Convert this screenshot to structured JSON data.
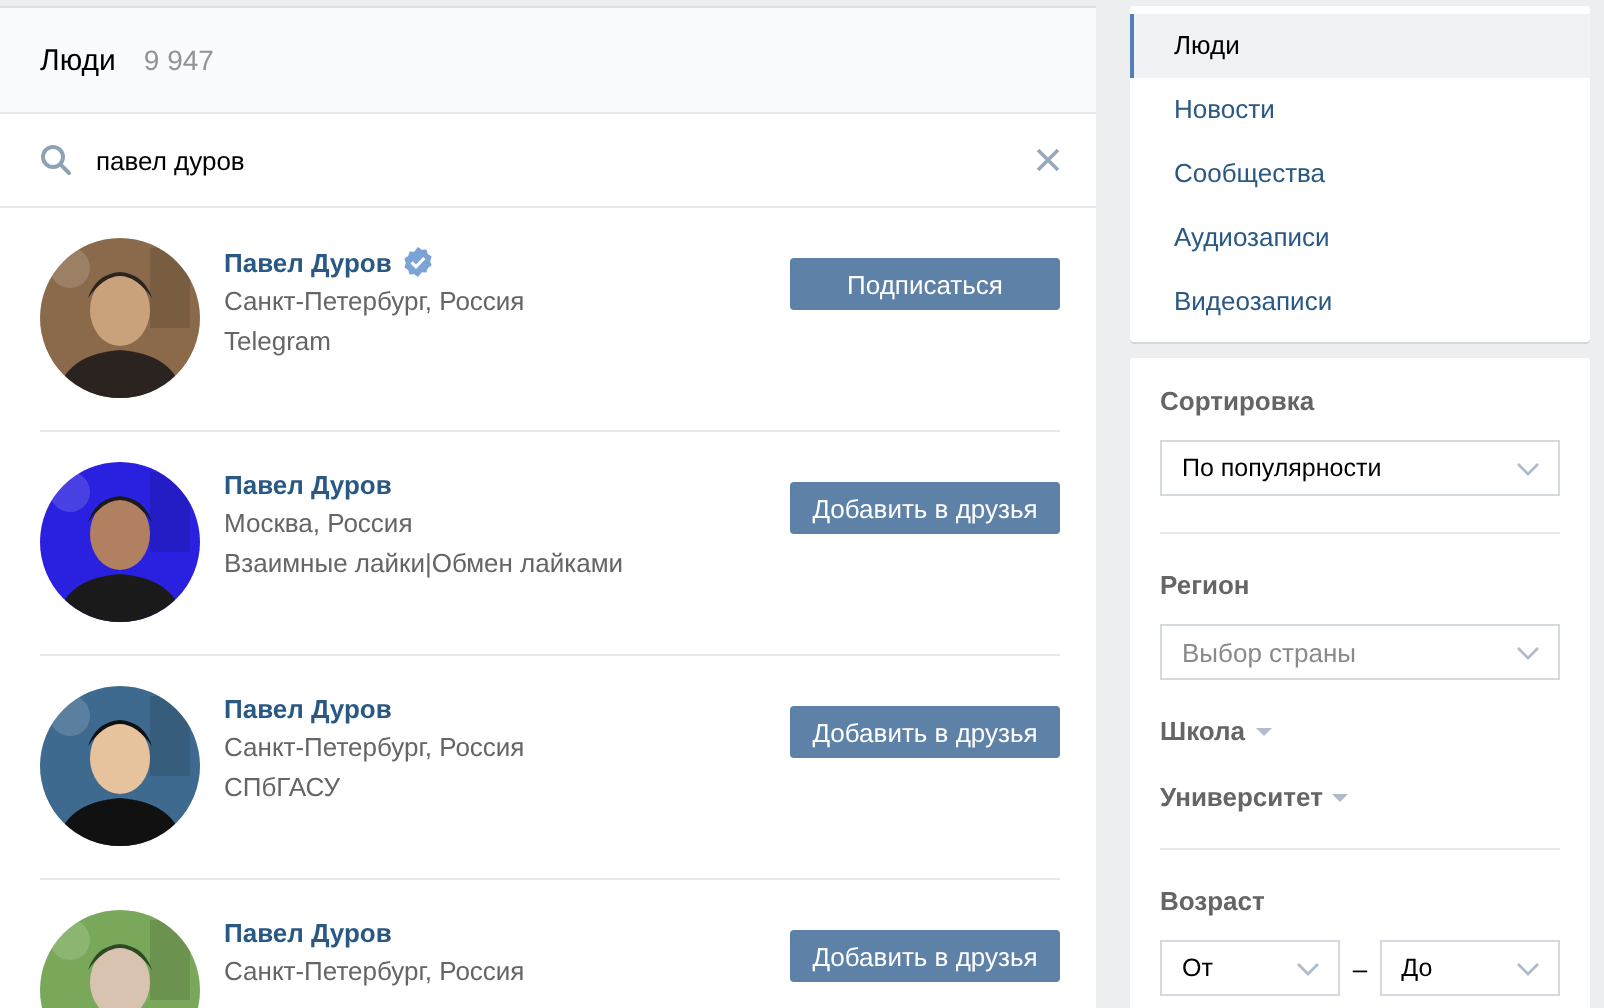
{
  "header": {
    "title": "Люди",
    "count": "9 947"
  },
  "search": {
    "value": "павел дуров"
  },
  "results": [
    {
      "name": "Павел Дуров",
      "verified": true,
      "location": "Санкт-Петербург, Россия",
      "info": "Telegram",
      "button": "Подписаться",
      "kind": "picture"
    },
    {
      "name": "Павел Дуров",
      "verified": false,
      "location": "Москва, Россия",
      "info": "Взаимные лайки|Обмен лайками",
      "button": "Добавить в друзья",
      "kind": "picture"
    },
    {
      "name": "Павел Дуров",
      "verified": false,
      "location": "Санкт-Петербург, Россия",
      "info": "СПбГАСУ",
      "button": "Добавить в друзья",
      "kind": "picture"
    },
    {
      "name": "Павел Дуров",
      "verified": false,
      "location": "Санкт-Петербург, Россия",
      "button": "Добавить в друзья",
      "kind": "picture"
    }
  ],
  "nav": [
    {
      "label": "Люди",
      "selected": true
    },
    {
      "label": "Новости",
      "selected": false
    },
    {
      "label": "Сообщества",
      "selected": false
    },
    {
      "label": "Аудиозаписи",
      "selected": false
    },
    {
      "label": "Видеозаписи",
      "selected": false
    }
  ],
  "filters": {
    "sort": {
      "label": "Сортировка",
      "value": "По популярности"
    },
    "region": {
      "label": "Регион",
      "placeholder": "Выбор страны"
    },
    "school": {
      "label": "Школа"
    },
    "university": {
      "label": "Университет"
    },
    "age": {
      "label": "Возраст",
      "from": "От",
      "separator": "–",
      "to": "До"
    }
  }
}
